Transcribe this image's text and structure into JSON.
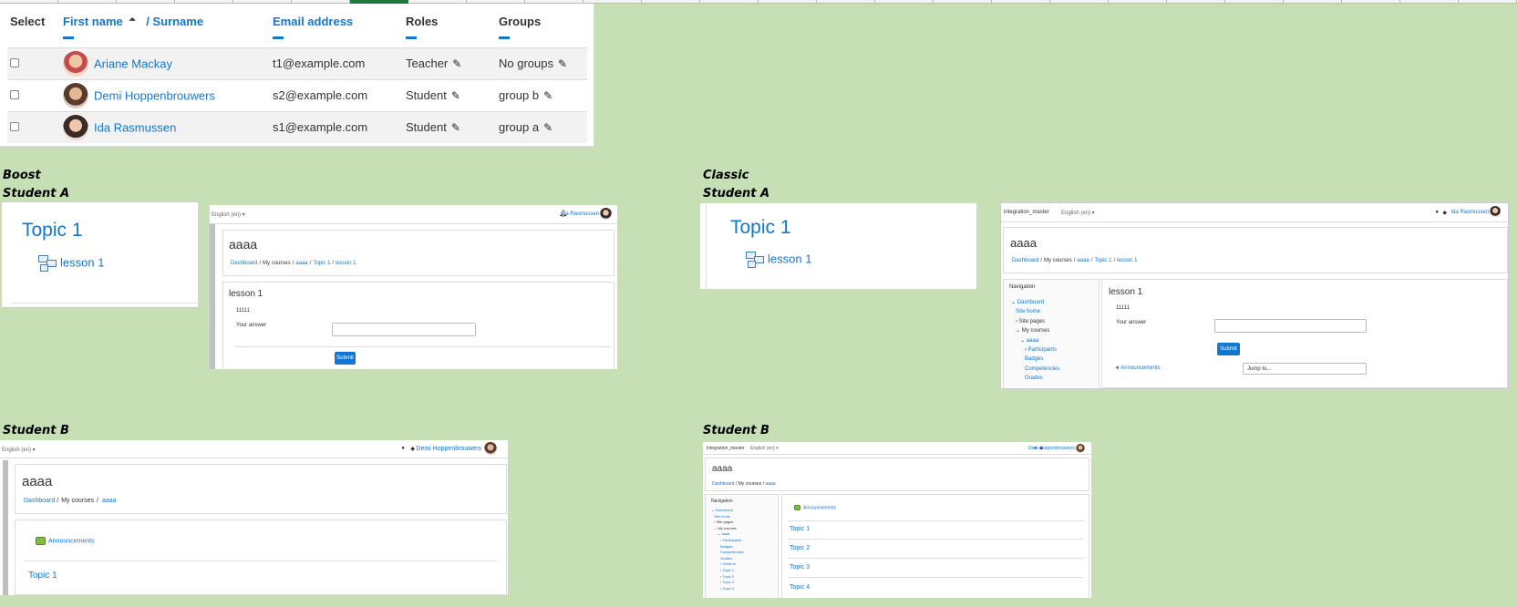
{
  "participants": {
    "headers": {
      "select": "Select",
      "first_name": "First name",
      "sort_arrow": "⏶",
      "surname": "/ Surname",
      "email": "Email address",
      "roles": "Roles",
      "groups": "Groups"
    },
    "rows": [
      {
        "name": "Ariane Mackay",
        "email": "t1@example.com",
        "role": "Teacher",
        "group": "No groups"
      },
      {
        "name": "Demi Hoppenbrouwers",
        "email": "s2@example.com",
        "role": "Student",
        "group": "group b"
      },
      {
        "name": "Ida Rasmussen",
        "email": "s1@example.com",
        "role": "Student",
        "group": "group a"
      }
    ],
    "pencil_icon": "✎"
  },
  "labels": {
    "boost": "Boost",
    "classic": "Classic",
    "student_a": "Student A",
    "student_b": "Student B"
  },
  "boost_a_topic": {
    "title": "Topic 1",
    "activity": "lesson 1"
  },
  "boost_a_lesson": {
    "lang": "English (en) ▾",
    "user": "Ida Rasmussen",
    "course": "aaaa",
    "crumbs": [
      "Dashboard",
      "My courses",
      "aaaa",
      "Topic 1",
      "lesson 1"
    ],
    "lesson_title": "lesson 1",
    "question": "11111",
    "answer_label": "Your answer",
    "submit": "Submit"
  },
  "classic_a_topic": {
    "title": "Topic 1",
    "activity": "lesson 1"
  },
  "classic_a_lesson": {
    "site": "integration_master",
    "lang": "English (en) ▾",
    "user": "Ida Rasmussen",
    "course": "aaaa",
    "crumbs": [
      "Dashboard",
      "My courses",
      "aaaa",
      "Topic 1",
      "lesson 1"
    ],
    "nav_title": "Navigation",
    "nav": [
      "Dashboard",
      "Site home",
      "Site pages",
      "My courses",
      "aaaa",
      "Participants",
      "Badges",
      "Competencies",
      "Grades"
    ],
    "lesson_title": "lesson 1",
    "question": "11111",
    "answer_label": "Your answer",
    "submit": "Submit",
    "prev_link": "◄ Announcements",
    "jump": "Jump to..."
  },
  "boost_b": {
    "lang": "English (en) ▾",
    "user": "Demi Hoppenbrouwers",
    "course": "aaaa",
    "crumbs": [
      "Dashboard",
      "My courses",
      "aaaa"
    ],
    "announcements": "Announcements",
    "topic": "Topic 1"
  },
  "classic_b": {
    "site": "integration_master",
    "lang": "English (en) ▾",
    "user": "Demi Hoppenbrouwers",
    "course": "aaaa",
    "crumbs": [
      "Dashboard",
      "My courses",
      "aaaa"
    ],
    "nav_title": "Navigation",
    "nav": [
      "Dashboard",
      "Site home",
      "Site pages",
      "My courses",
      "aaaa",
      "Participants",
      "Badges",
      "Competencies",
      "Grades",
      "General",
      "Topic 1",
      "Topic 2",
      "Topic 3",
      "Topic 4"
    ],
    "announcements": "Announcements",
    "topics": [
      "Topic 1",
      "Topic 2",
      "Topic 3",
      "Topic 4"
    ]
  }
}
